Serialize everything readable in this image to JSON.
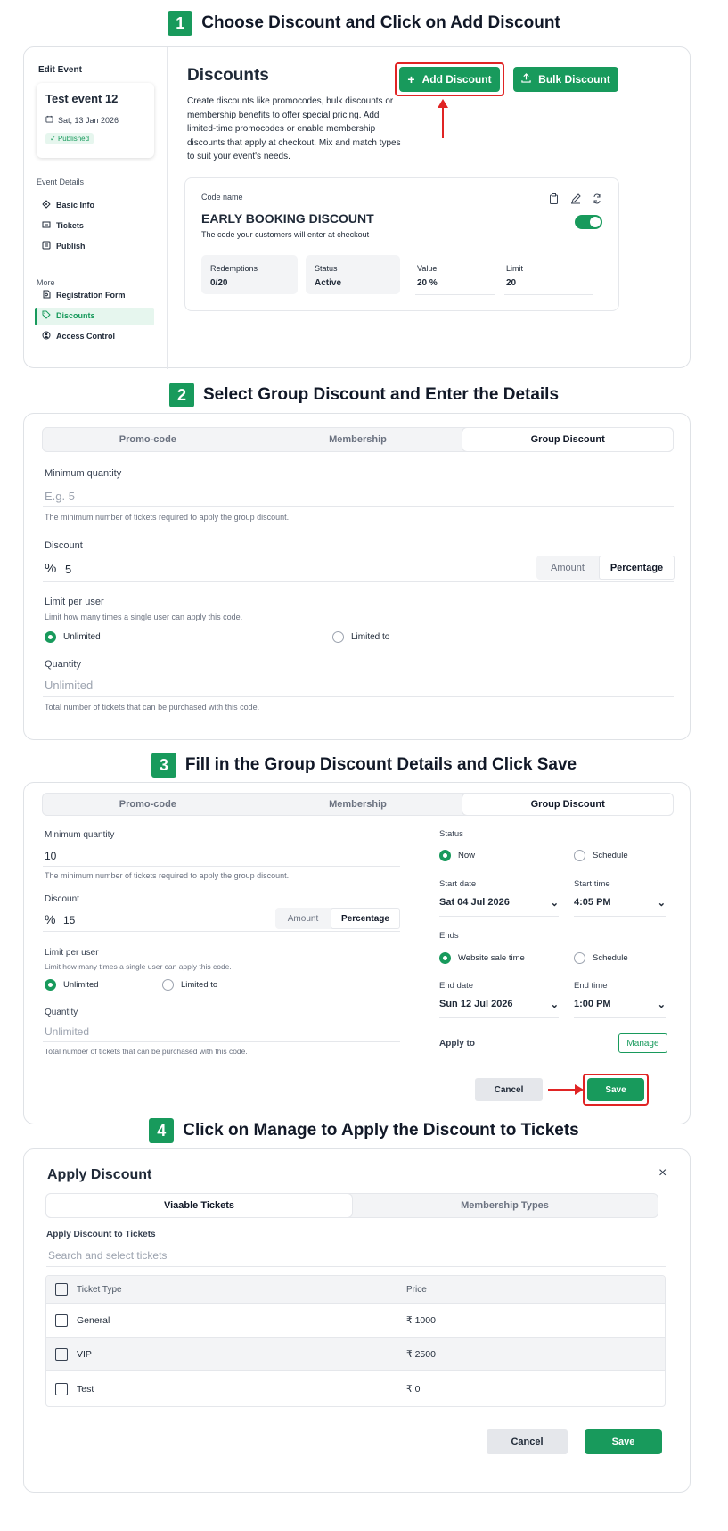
{
  "steps": [
    {
      "num": "1",
      "text": "Choose Discount and Click on Add Discount"
    },
    {
      "num": "2",
      "text": "Select Group Discount and Enter the Details"
    },
    {
      "num": "3",
      "text": "Fill in the Group Discount Details and Click Save"
    },
    {
      "num": "4",
      "text": "Click on Manage to Apply the Discount to Tickets"
    }
  ],
  "sidebar": {
    "edit_event": "Edit Event",
    "event_name": "Test event 12",
    "event_date": "Sat, 13 Jan 2026",
    "status": "Published",
    "section1": "Event Details",
    "items1": [
      "Basic Info",
      "Tickets",
      "Publish"
    ],
    "section2": "More",
    "items2": [
      "Registration Form",
      "Discounts",
      "Access Control"
    ]
  },
  "discounts": {
    "title": "Discounts",
    "desc": "Create discounts like promocodes, bulk discounts or membership benefits to offer special pricing. Add limited-time promocodes or enable membership discounts that apply at checkout. Mix and match types to suit your event's needs.",
    "add_label": "Add Discount",
    "bulk_label": "Bulk Discount",
    "code_label": "Code name",
    "code_name": "EARLY BOOKING DISCOUNT",
    "code_hint": "The code your customers will enter at checkout",
    "stats": [
      {
        "label": "Redemptions",
        "value": "0/20"
      },
      {
        "label": "Status",
        "value": "Active"
      },
      {
        "label": "Value",
        "value": "20 %"
      },
      {
        "label": "Limit",
        "value": "20"
      }
    ]
  },
  "form2": {
    "tabs": [
      "Promo-code",
      "Membership",
      "Group Discount"
    ],
    "min_qty_label": "Minimum quantity",
    "min_qty_placeholder": "E.g. 5",
    "min_qty_hint": "The minimum number of tickets required to apply the group discount.",
    "discount_label": "Discount",
    "discount_symbol": "%",
    "discount_value": "5",
    "seg": [
      "Amount",
      "Percentage"
    ],
    "limit_label": "Limit per user",
    "limit_hint": "Limit how many times a single user can apply this code.",
    "radio_unlimited": "Unlimited",
    "radio_limited": "Limited to",
    "qty_label": "Quantity",
    "qty_placeholder": "Unlimited",
    "qty_hint": "Total number of tickets that can be purchased with this code."
  },
  "form3": {
    "tabs": [
      "Promo-code",
      "Membership",
      "Group Discount"
    ],
    "min_qty_label": "Minimum quantity",
    "min_qty_value": "10",
    "min_qty_hint": "The minimum number of tickets required to apply the group discount.",
    "discount_label": "Discount",
    "discount_symbol": "%",
    "discount_value": "15",
    "seg": [
      "Amount",
      "Percentage"
    ],
    "limit_label": "Limit per user",
    "limit_hint": "Limit how many times a single user can apply this code.",
    "radio_unlimited": "Unlimited",
    "radio_limited": "Limited to",
    "qty_label": "Quantity",
    "qty_placeholder": "Unlimited",
    "qty_hint": "Total number of tickets that can be purchased with this code.",
    "status_label": "Status",
    "status_now": "Now",
    "status_schedule": "Schedule",
    "start_date_label": "Start date",
    "start_date": "Sat 04 Jul 2026",
    "start_time_label": "Start time",
    "start_time": "4:05 PM",
    "ends_label": "Ends",
    "ends_website": "Website sale time",
    "ends_schedule": "Schedule",
    "end_date_label": "End date",
    "end_date": "Sun 12 Jul 2026",
    "end_time_label": "End time",
    "end_time": "1:00 PM",
    "apply_label": "Apply to",
    "manage_label": "Manage",
    "cancel_label": "Cancel",
    "save_label": "Save"
  },
  "apply": {
    "title": "Apply Discount",
    "tabs": [
      "Viaable Tickets",
      "Membership Types"
    ],
    "section": "Apply Discount to Tickets",
    "search_placeholder": "Search and select tickets",
    "col_type": "Ticket Type",
    "col_price": "Price",
    "rows": [
      {
        "type": "General",
        "price": "₹ 1000"
      },
      {
        "type": "VIP",
        "price": "₹ 2500"
      },
      {
        "type": "Test",
        "price": "₹ 0"
      }
    ],
    "cancel_label": "Cancel",
    "save_label": "Save"
  },
  "colors": {
    "accent": "#189a5c",
    "highlight": "#e02424"
  }
}
